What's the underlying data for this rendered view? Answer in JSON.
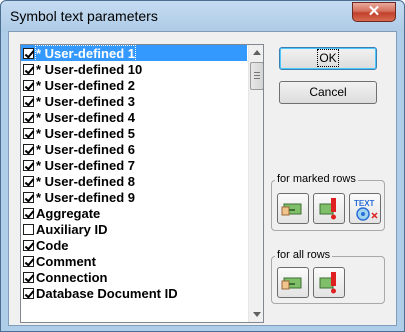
{
  "window": {
    "title": "Symbol text parameters",
    "close_glyph": "✕"
  },
  "list": {
    "items": [
      {
        "label": "* User-defined 1",
        "checked": true,
        "selected": true
      },
      {
        "label": "* User-defined 10",
        "checked": true
      },
      {
        "label": "* User-defined 2",
        "checked": true
      },
      {
        "label": "* User-defined 3",
        "checked": true
      },
      {
        "label": "* User-defined 4",
        "checked": true
      },
      {
        "label": "* User-defined 5",
        "checked": true
      },
      {
        "label": "* User-defined 6",
        "checked": true
      },
      {
        "label": "* User-defined 7",
        "checked": true
      },
      {
        "label": "* User-defined 8",
        "checked": true
      },
      {
        "label": "* User-defined 9",
        "checked": true
      },
      {
        "label": "Aggregate",
        "checked": true
      },
      {
        "label": "Auxiliary ID",
        "checked": false
      },
      {
        "label": "Code",
        "checked": true
      },
      {
        "label": "Comment",
        "checked": true
      },
      {
        "label": "Connection",
        "checked": true
      },
      {
        "label": "Database Document ID",
        "checked": true
      }
    ]
  },
  "buttons": {
    "ok": "OK",
    "cancel": "Cancel"
  },
  "groups": {
    "marked_label": "for marked rows",
    "all_label": "for all rows"
  },
  "icons": {
    "marked": [
      "checkmark-hand-icon",
      "uncheck-exclamation-icon",
      "text-settings-icon"
    ],
    "all": [
      "checkmark-hand-icon",
      "uncheck-exclamation-icon"
    ]
  },
  "colors": {
    "selection": "#3399ff",
    "close_button": "#c0412b",
    "title_bar": "#aecde9"
  }
}
